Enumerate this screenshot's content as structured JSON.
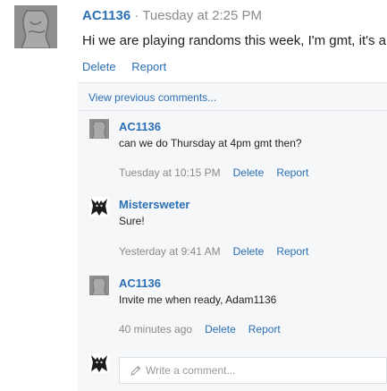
{
  "post": {
    "author": "AC1136",
    "separator": "·",
    "time": "Tuesday at 2:25 PM",
    "body": "Hi we are playing randoms this week, I'm gmt, it's a",
    "actions": {
      "delete": "Delete",
      "report": "Report"
    }
  },
  "comments": {
    "view_previous": "View previous comments...",
    "items": [
      {
        "author": "AC1136",
        "text": "can we do Thursday at 4pm gmt then?",
        "time": "Tuesday at 10:15 PM",
        "delete": "Delete",
        "report": "Report",
        "avatar": "grey-figure-avatar"
      },
      {
        "author": "Mistersweter",
        "text": "Sure!",
        "time": "Yesterday at 9:41 AM",
        "delete": "Delete",
        "report": "Report",
        "avatar": "dark-creature-avatar"
      },
      {
        "author": "AC1136",
        "text": "Invite me when ready, Adam1136",
        "time": "40 minutes ago",
        "delete": "Delete",
        "report": "Report",
        "avatar": "grey-figure-avatar"
      }
    ],
    "compose": {
      "placeholder": "Write a comment...",
      "icon": "pencil-icon"
    }
  },
  "colors": {
    "link": "#2a6fb5",
    "muted": "#8a8a8a",
    "panel_bg": "#f6f7f9"
  }
}
